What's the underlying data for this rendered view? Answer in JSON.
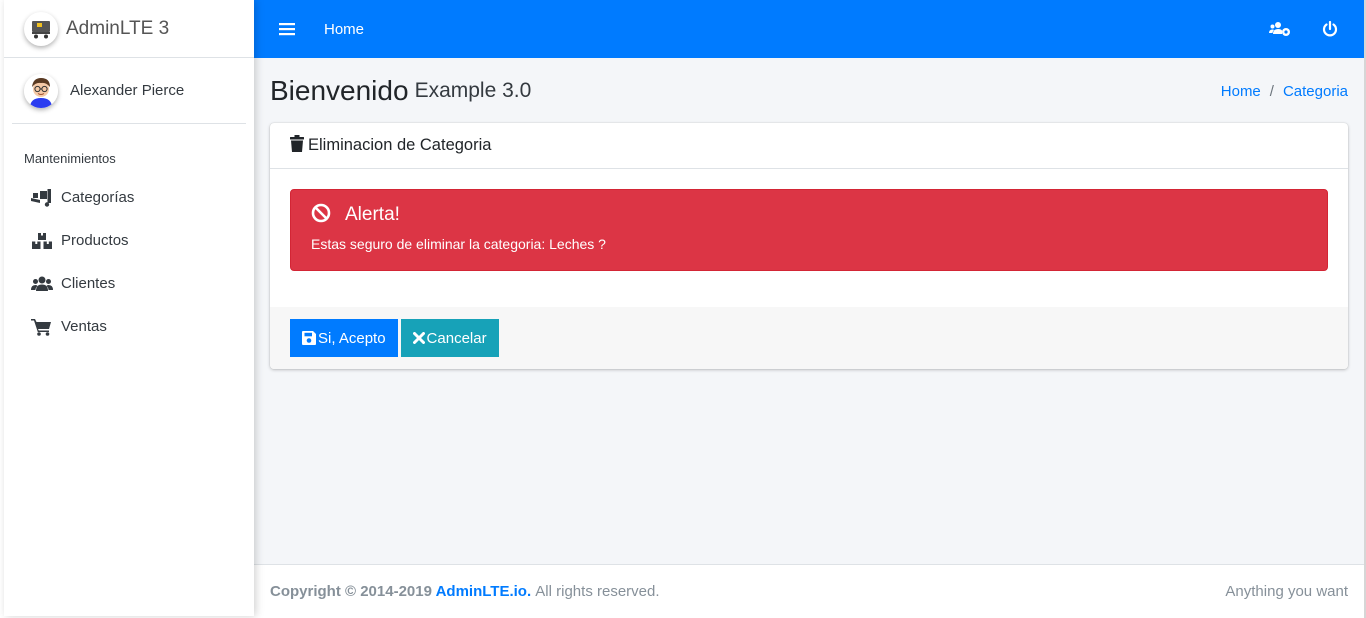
{
  "brand": {
    "name": "AdminLTE 3"
  },
  "user": {
    "name": "Alexander Pierce"
  },
  "sidebar": {
    "header": "Mantenimientos",
    "items": [
      {
        "label": "Categorías",
        "icon": "dolly-icon"
      },
      {
        "label": "Productos",
        "icon": "boxes-icon"
      },
      {
        "label": "Clientes",
        "icon": "users-icon"
      },
      {
        "label": "Ventas",
        "icon": "shopping-cart-icon"
      }
    ]
  },
  "topbar": {
    "home_label": "Home",
    "accent": "#007bff"
  },
  "page": {
    "title": "Bienvenido",
    "subtitle": "Example 3.0",
    "breadcrumb": [
      "Home",
      "Categoria"
    ]
  },
  "card": {
    "title": "Eliminacion de Categoria",
    "alert_title": "Alerta!",
    "alert_text": "Estas seguro de eliminar la categoria: Leches ?",
    "alert_color": "#dc3545",
    "accept_label": "Si, Acepto",
    "cancel_label": "Cancelar"
  },
  "footer": {
    "copyright": "Copyright © 2014-2019",
    "link": "AdminLTE.io.",
    "rights": "All rights reserved.",
    "right_text": "Anything you want"
  }
}
